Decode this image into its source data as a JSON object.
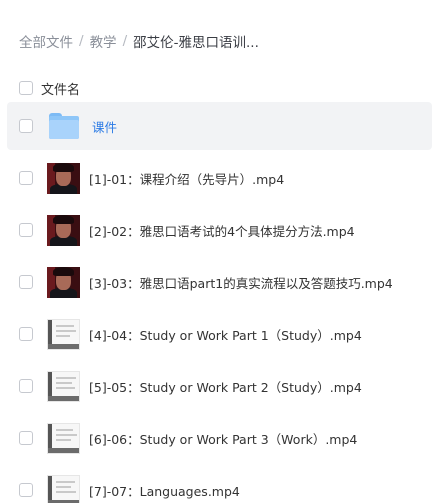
{
  "breadcrumb": {
    "items": [
      {
        "label": "全部文件"
      },
      {
        "label": "教学"
      }
    ],
    "separator": "/",
    "current": "邵艾伦-雅思口语训..."
  },
  "list_header": {
    "column_label": "文件名"
  },
  "files": [
    {
      "name": "课件",
      "type": "folder",
      "icon": "folder-icon"
    },
    {
      "name": "[1]-01：课程介绍（先导片）.mp4",
      "type": "video",
      "icon": "video-thumbnail-portrait"
    },
    {
      "name": "[2]-02：雅思口语考试的4个具体提分方法.mp4",
      "type": "video",
      "icon": "video-thumbnail-portrait"
    },
    {
      "name": "[3]-03：雅思口语part1的真实流程以及答题技巧.mp4",
      "type": "video",
      "icon": "video-thumbnail-portrait"
    },
    {
      "name": "[4]-04：Study or Work Part 1（Study）.mp4",
      "type": "video",
      "icon": "video-thumbnail-slide"
    },
    {
      "name": "[5]-05：Study or Work Part 2（Study）.mp4",
      "type": "video",
      "icon": "video-thumbnail-slide"
    },
    {
      "name": "[6]-06：Study or Work Part 3（Work）.mp4",
      "type": "video",
      "icon": "video-thumbnail-slide"
    },
    {
      "name": "[7]-07：Languages.mp4",
      "type": "video",
      "icon": "video-thumbnail-slide"
    }
  ],
  "colors": {
    "folder_link": "#2c7be5",
    "selected_row_bg": "#f2f3f5",
    "breadcrumb_muted": "#8a8f99"
  }
}
